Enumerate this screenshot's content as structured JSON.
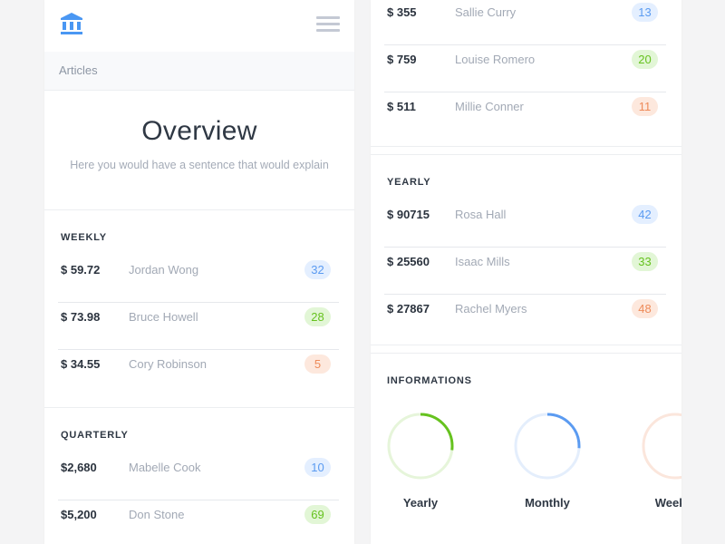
{
  "header": {
    "logo_icon": "bank-icon",
    "menu_icon": "hamburger-menu-icon",
    "breadcrumb": "Articles"
  },
  "overview": {
    "title": "Overview",
    "subtitle": "Here you would have a sentence that would explain"
  },
  "colors": {
    "blue": "#5b9bf1",
    "green": "#66c21f",
    "orange": "#ee8b5a",
    "title_text": "#2f3844",
    "muted_text": "#a2a9b5"
  },
  "weekly": {
    "title": "WEEKLY",
    "rows": [
      {
        "amount": "$ 59.72",
        "name": "Jordan Wong",
        "badge": "32",
        "color": "blue"
      },
      {
        "amount": "$ 73.98",
        "name": "Bruce Howell",
        "badge": "28",
        "color": "green"
      },
      {
        "amount": "$ 34.55",
        "name": "Cory Robinson",
        "badge": "5",
        "color": "orange"
      }
    ]
  },
  "quarterly": {
    "title": "QUARTERLY",
    "rows": [
      {
        "amount": "$2,680",
        "name": "Mabelle Cook",
        "badge": "10",
        "color": "blue"
      },
      {
        "amount": "$5,200",
        "name": "Don Stone",
        "badge": "69",
        "color": "green"
      }
    ]
  },
  "monthly_continued": {
    "rows": [
      {
        "amount": "$ 355",
        "name": "Sallie Curry",
        "badge": "13",
        "color": "blue"
      },
      {
        "amount": "$ 759",
        "name": "Louise Romero",
        "badge": "20",
        "color": "green"
      },
      {
        "amount": "$ 511",
        "name": "Millie Conner",
        "badge": "11",
        "color": "orange"
      }
    ]
  },
  "yearly": {
    "title": "YEARLY",
    "rows": [
      {
        "amount": "$ 90715",
        "name": "Rosa Hall",
        "badge": "42",
        "color": "blue"
      },
      {
        "amount": "$ 25560",
        "name": "Isaac Mills",
        "badge": "33",
        "color": "green"
      },
      {
        "amount": "$ 27867",
        "name": "Rachel Myers",
        "badge": "48",
        "color": "orange"
      }
    ]
  },
  "informations": {
    "title": "INFORMATIONS",
    "rings": [
      {
        "label": "Yearly",
        "progress": 0.27,
        "color": "#66c21f",
        "track": "#e6f5da"
      },
      {
        "label": "Monthly",
        "progress": 0.26,
        "color": "#5b9bf1",
        "track": "#e4eefc"
      },
      {
        "label": "Weekly",
        "visible_label": "Wee",
        "progress": 0,
        "color": "#ee8b5a",
        "track": "#fbe6dc"
      }
    ]
  }
}
